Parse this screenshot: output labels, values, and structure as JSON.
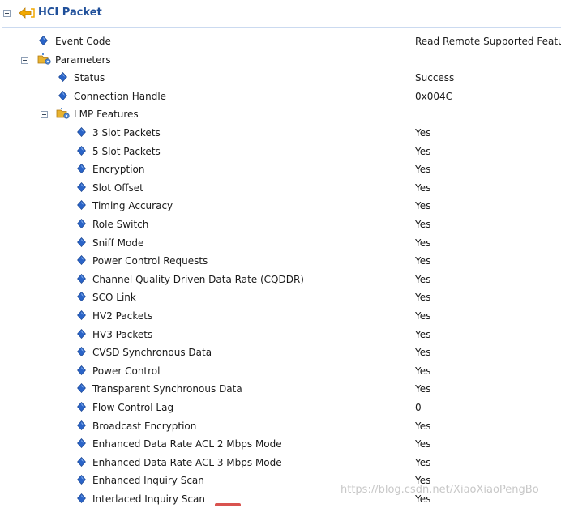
{
  "root": {
    "label": "HCI Packet"
  },
  "rows": [
    {
      "label": "Event Code",
      "value": "Read Remote Supported Featu",
      "level": 1,
      "kind": "leaf"
    },
    {
      "label": "Parameters",
      "value": "",
      "level": 1,
      "kind": "group"
    },
    {
      "label": "Status",
      "value": "Success",
      "level": 2,
      "kind": "leaf"
    },
    {
      "label": "Connection Handle",
      "value": "0x004C",
      "level": 2,
      "kind": "leaf"
    },
    {
      "label": "LMP Features",
      "value": "",
      "level": 2,
      "kind": "group"
    },
    {
      "label": "3 Slot Packets",
      "value": "Yes",
      "level": 3,
      "kind": "leaf"
    },
    {
      "label": "5 Slot Packets",
      "value": "Yes",
      "level": 3,
      "kind": "leaf"
    },
    {
      "label": "Encryption",
      "value": "Yes",
      "level": 3,
      "kind": "leaf"
    },
    {
      "label": "Slot Offset",
      "value": "Yes",
      "level": 3,
      "kind": "leaf"
    },
    {
      "label": "Timing Accuracy",
      "value": "Yes",
      "level": 3,
      "kind": "leaf"
    },
    {
      "label": "Role Switch",
      "value": "Yes",
      "level": 3,
      "kind": "leaf"
    },
    {
      "label": "Sniff Mode",
      "value": "Yes",
      "level": 3,
      "kind": "leaf"
    },
    {
      "label": "Power Control Requests",
      "value": "Yes",
      "level": 3,
      "kind": "leaf"
    },
    {
      "label": "Channel Quality Driven Data Rate (CQDDR)",
      "value": "Yes",
      "level": 3,
      "kind": "leaf"
    },
    {
      "label": "SCO Link",
      "value": "Yes",
      "level": 3,
      "kind": "leaf"
    },
    {
      "label": "HV2 Packets",
      "value": "Yes",
      "level": 3,
      "kind": "leaf"
    },
    {
      "label": "HV3 Packets",
      "value": "Yes",
      "level": 3,
      "kind": "leaf"
    },
    {
      "label": "CVSD Synchronous Data",
      "value": "Yes",
      "level": 3,
      "kind": "leaf"
    },
    {
      "label": "Power Control",
      "value": "Yes",
      "level": 3,
      "kind": "leaf"
    },
    {
      "label": "Transparent Synchronous Data",
      "value": "Yes",
      "level": 3,
      "kind": "leaf"
    },
    {
      "label": "Flow Control Lag",
      "value": "0",
      "level": 3,
      "kind": "leaf"
    },
    {
      "label": "Broadcast Encryption",
      "value": "Yes",
      "level": 3,
      "kind": "leaf"
    },
    {
      "label": "Enhanced Data Rate ACL 2 Mbps Mode",
      "value": "Yes",
      "level": 3,
      "kind": "leaf"
    },
    {
      "label": "Enhanced Data Rate ACL 3 Mbps Mode",
      "value": "Yes",
      "level": 3,
      "kind": "leaf"
    },
    {
      "label": "Enhanced Inquiry Scan",
      "value": "Yes",
      "level": 3,
      "kind": "leaf"
    },
    {
      "label": "Interlaced Inquiry Scan",
      "value": "Yes",
      "level": 3,
      "kind": "leaf"
    }
  ],
  "watermark": "https://blog.csdn.net/XiaoXiaoPengBo",
  "colors": {
    "diamond": "#2a64c8",
    "folder": "#e8b330",
    "root_label": "#1f4f9a",
    "arrow": "#f2a900"
  },
  "icons": {
    "root": "back-arrow-icon",
    "leaf": "diamond-icon",
    "group": "folder-gear-icon",
    "expander": "collapse-icon"
  }
}
